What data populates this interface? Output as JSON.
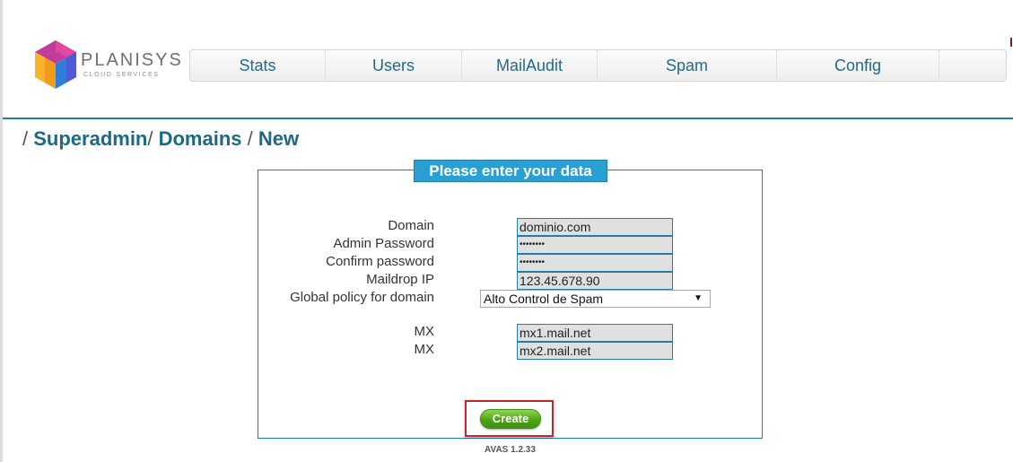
{
  "brand": {
    "name": "PLANISYS",
    "tagline": "CLOUD·SERVICES"
  },
  "nav": {
    "items": [
      {
        "label": "Stats"
      },
      {
        "label": "Users"
      },
      {
        "label": "MailAudit"
      },
      {
        "label": "Spam"
      },
      {
        "label": "Config"
      }
    ]
  },
  "breadcrumb": {
    "prefix": "/ ",
    "items": [
      "Superadmin",
      "Domains"
    ],
    "current": "New",
    "sep1": "/ ",
    "sep2": " / "
  },
  "form": {
    "legend": "Please enter your data",
    "domain_label": "Domain",
    "domain_value": "dominio.com",
    "admin_password_label": "Admin Password",
    "admin_password_value": "••••••••",
    "confirm_password_label": "Confirm password",
    "confirm_password_value": "••••••••",
    "maildrop_ip_label": "Maildrop IP",
    "maildrop_ip_value": "123.45.678.90",
    "policy_label": "Global policy for domain",
    "policy_value": "Alto Control de Spam",
    "mx1_label": "MX",
    "mx1_value": "mx1.mail.net",
    "mx2_label": "MX",
    "mx2_value": "mx2.mail.net",
    "create_label": "Create"
  },
  "footer": {
    "version": "AVAS 1.2.33"
  },
  "colors": {
    "accent": "#1f7fa6",
    "legend_bg": "#2a9fd6",
    "button_green": "#4ea514",
    "highlight_red": "#c4252a"
  }
}
